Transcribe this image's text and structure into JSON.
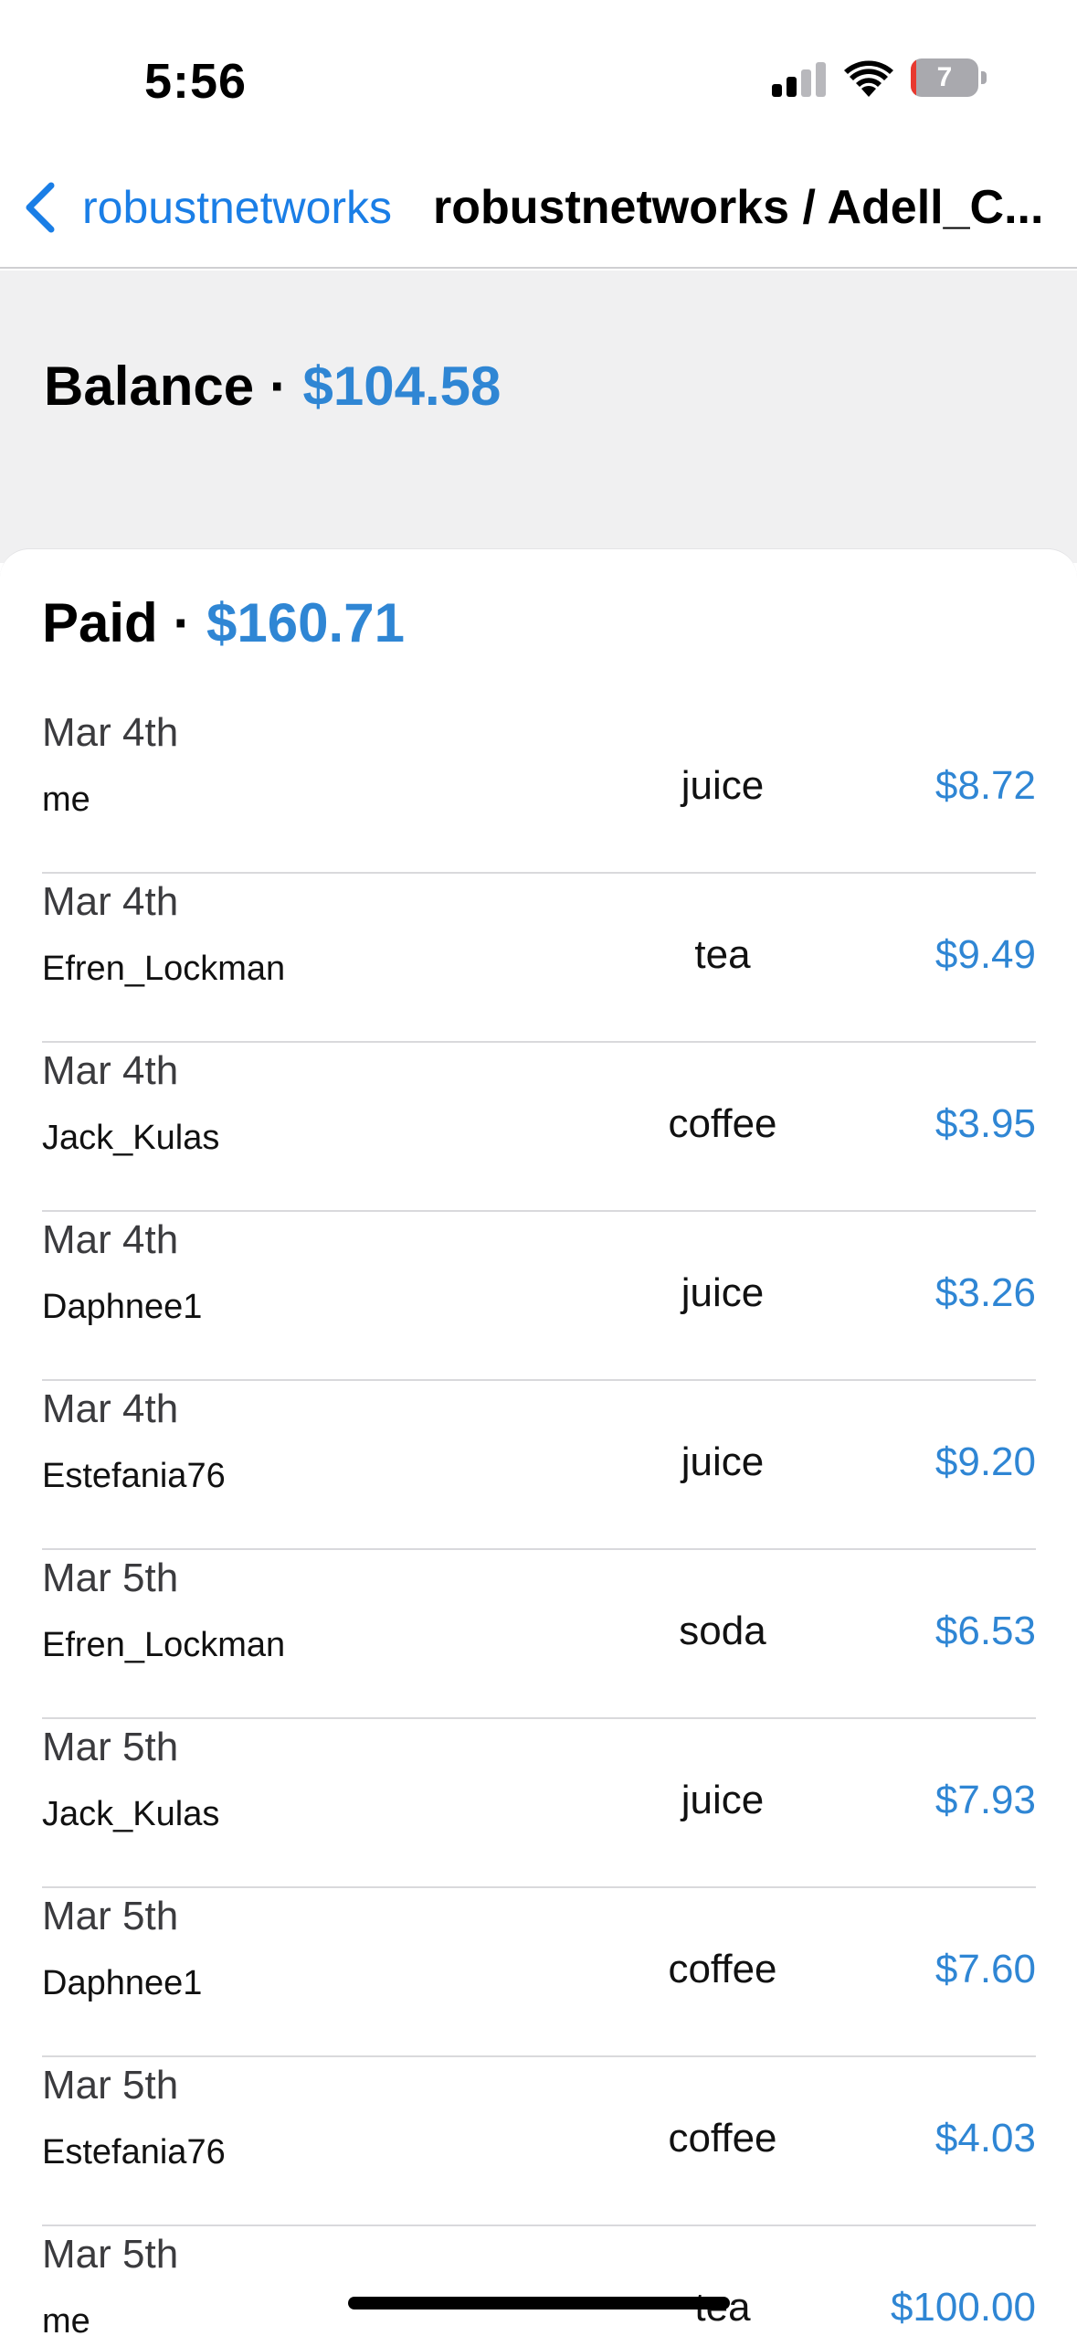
{
  "status_bar": {
    "time": "5:56",
    "battery_level": "7",
    "battery_fraction": 0.07
  },
  "nav": {
    "back_label": "robustnetworks",
    "title": "robustnetworks / Adell_C..."
  },
  "balance": {
    "label": "Balance",
    "separator": "·",
    "amount": "$104.58"
  },
  "paid": {
    "label": "Paid",
    "separator": "·",
    "amount": "$160.71"
  },
  "transactions": [
    {
      "date": "Mar 4th",
      "person": "me",
      "item": "juice",
      "amount": "$8.72"
    },
    {
      "date": "Mar 4th",
      "person": "Efren_Lockman",
      "item": "tea",
      "amount": "$9.49"
    },
    {
      "date": "Mar 4th",
      "person": "Jack_Kulas",
      "item": "coffee",
      "amount": "$3.95"
    },
    {
      "date": "Mar 4th",
      "person": "Daphnee1",
      "item": "juice",
      "amount": "$3.26"
    },
    {
      "date": "Mar 4th",
      "person": "Estefania76",
      "item": "juice",
      "amount": "$9.20"
    },
    {
      "date": "Mar 5th",
      "person": "Efren_Lockman",
      "item": "soda",
      "amount": "$6.53"
    },
    {
      "date": "Mar 5th",
      "person": "Jack_Kulas",
      "item": "juice",
      "amount": "$7.93"
    },
    {
      "date": "Mar 5th",
      "person": "Daphnee1",
      "item": "coffee",
      "amount": "$7.60"
    },
    {
      "date": "Mar 5th",
      "person": "Estefania76",
      "item": "coffee",
      "amount": "$4.03"
    },
    {
      "date": "Mar 5th",
      "person": "me",
      "item": "tea",
      "amount": "$100.00"
    }
  ],
  "colors": {
    "accent": "#1a7ee6",
    "amount": "#2f86d4",
    "balance_bg": "#f0f0f1",
    "battery_low": "#e8392f"
  },
  "icons": {
    "back": "chevron-left-icon",
    "signal": "cellular-signal-icon",
    "wifi": "wifi-icon",
    "battery": "battery-icon"
  }
}
